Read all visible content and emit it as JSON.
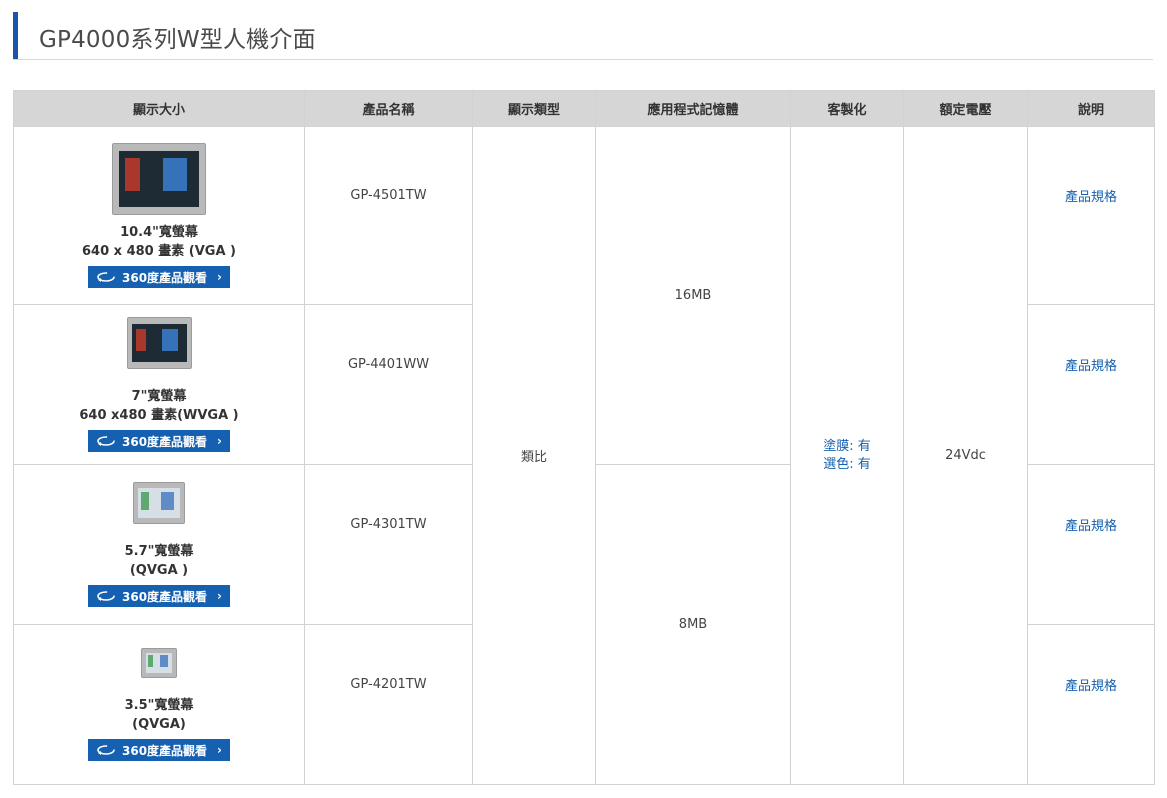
{
  "page": {
    "title": "GP4000系列W型人機介面"
  },
  "table": {
    "headers": [
      "顯示大小",
      "產品名稱",
      "顯示類型",
      "應用程式記憶體",
      "客製化",
      "額定電壓",
      "說明"
    ],
    "rows": [
      {
        "display_line1": "10.4\"寬螢幕",
        "display_line2": "640 x 480 畫素 (VGA )",
        "model": "GP-4501TW",
        "link": "產品規格"
      },
      {
        "display_line1": "7\"寬螢幕",
        "display_line2": "640 x480 畫素(WVGA )",
        "model": "GP-4401WW",
        "link": "產品規格"
      },
      {
        "display_line1": "5.7\"寬螢幕",
        "display_line2": "(QVGA )",
        "model": "GP-4301TW",
        "link": "產品規格"
      },
      {
        "display_line1": "3.5\"寬螢幕",
        "display_line2": "(QVGA)",
        "model": "GP-4201TW",
        "link": "產品規格"
      }
    ],
    "display_type": "類比",
    "memory_top": "16MB",
    "memory_bottom": "8MB",
    "custom_line1": "塗膜: 有",
    "custom_line2": "選色: 有",
    "voltage": "24Vdc",
    "view_button_label": "360度產品觀看"
  },
  "icons": {
    "rotate": "rotate-360-icon",
    "chevron": "chevron-right-icon"
  },
  "colors": {
    "accent": "#1a56a8",
    "button": "#1560b0",
    "header_bg": "#d6d6d6"
  }
}
